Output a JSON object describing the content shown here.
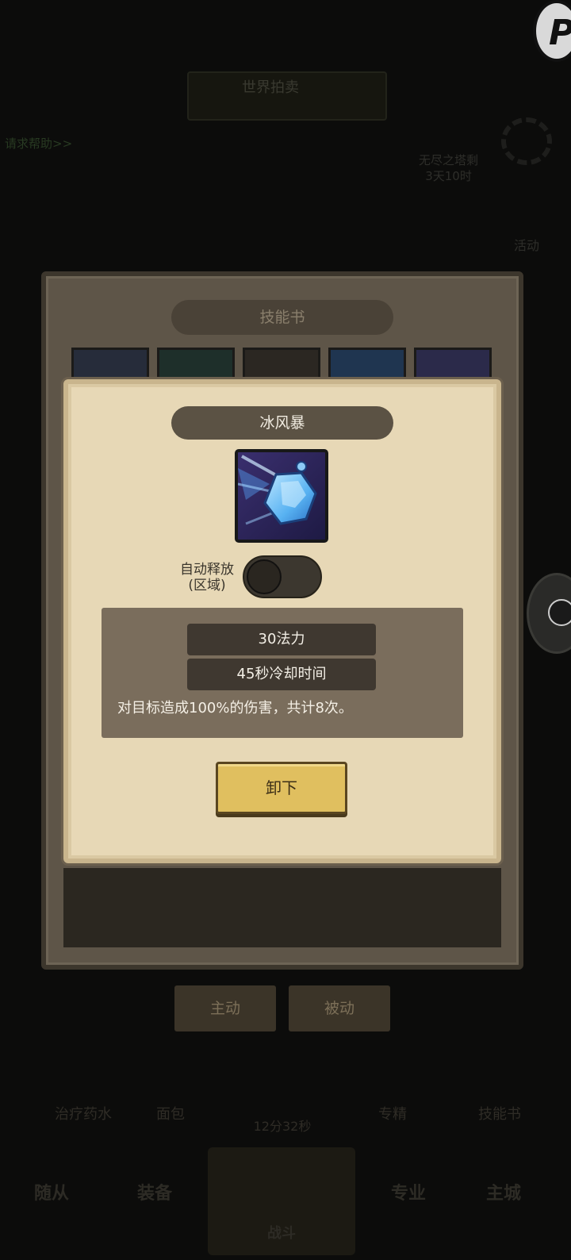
{
  "background": {
    "banner_text": "世界拍卖",
    "link_text": "请求帮助>>",
    "timer_line1": "无尽之塔剩",
    "timer_line2": "3天10时",
    "side_label": "活动",
    "tabs": [
      "主动",
      "被动"
    ],
    "items": [
      "治疗药水",
      "面包",
      "专精",
      "技能书"
    ],
    "center_timer": "12分32秒",
    "nav": [
      "随从",
      "装备",
      "战斗",
      "专业",
      "主城"
    ]
  },
  "skill_book": {
    "title": "技能书"
  },
  "skill_detail": {
    "name": "冰风暴",
    "icon": "ice-storm-icon",
    "auto_cast_label_1": "自动释放",
    "auto_cast_label_2": "(区域)",
    "auto_cast_on": false,
    "mana_cost": "30法力",
    "cooldown": "45秒冷却时间",
    "description": "对目标造成100%的伤害，共计8次。",
    "unequip_label": "卸下"
  },
  "colors": {
    "accent_gold": "#e0bf5f",
    "parchment": "#e7d8b6",
    "info_panel": "#7a6d5c"
  }
}
